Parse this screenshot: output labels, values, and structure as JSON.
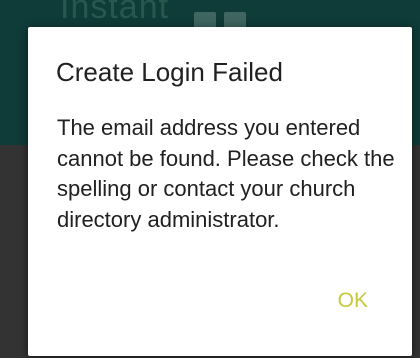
{
  "background_app": {
    "header_title": "Instant"
  },
  "dialog": {
    "title": "Create Login Failed",
    "message": "The email address you entered cannot be found. Please check the spelling or contact your church directory administrator.",
    "ok_label": "OK"
  },
  "colors": {
    "header_bg": "#0f3b38",
    "dim_bg": "#333333",
    "dialog_bg": "#ffffff",
    "text": "#212121",
    "ok_accent": "#c6c93c"
  }
}
